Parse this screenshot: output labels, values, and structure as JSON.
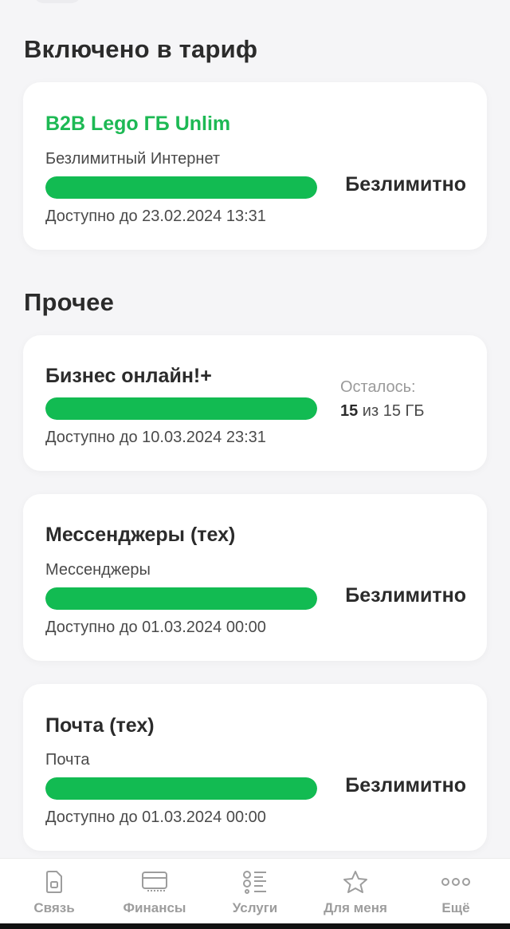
{
  "sections": {
    "included_title": "Включено в тариф",
    "other_title": "Прочее"
  },
  "cards": [
    {
      "title": "B2B Lego ГБ Unlim",
      "subtitle": "Безлимитный Интернет",
      "amount": "Безлимитно",
      "available": "Доступно до 23.02.2024 13:31",
      "progress": 1.0
    },
    {
      "title": "Бизнес онлайн!+",
      "remaining_label": "Осталось:",
      "remaining_current": "15",
      "remaining_rest": " из 15 ГБ",
      "available": "Доступно до 10.03.2024 23:31",
      "progress": 1.0
    },
    {
      "title": "Мессенджеры (тех)",
      "subtitle": "Мессенджеры",
      "amount": "Безлимитно",
      "available": "Доступно до 01.03.2024 00:00",
      "progress": 1.0
    },
    {
      "title": "Почта (тех)",
      "subtitle": "Почта",
      "amount": "Безлимитно",
      "available": "Доступно до 01.03.2024 00:00",
      "progress": 1.0
    }
  ],
  "tabs": [
    {
      "label": "Связь",
      "icon": "sim-card-icon"
    },
    {
      "label": "Финансы",
      "icon": "wallet-icon"
    },
    {
      "label": "Услуги",
      "icon": "services-list-icon"
    },
    {
      "label": "Для меня",
      "icon": "star-icon"
    },
    {
      "label": "Ещё",
      "icon": "more-dots-icon"
    }
  ],
  "colors": {
    "accent_green": "#12bb52",
    "title_green": "#1db954",
    "tab_inactive": "#9d9d9d"
  }
}
